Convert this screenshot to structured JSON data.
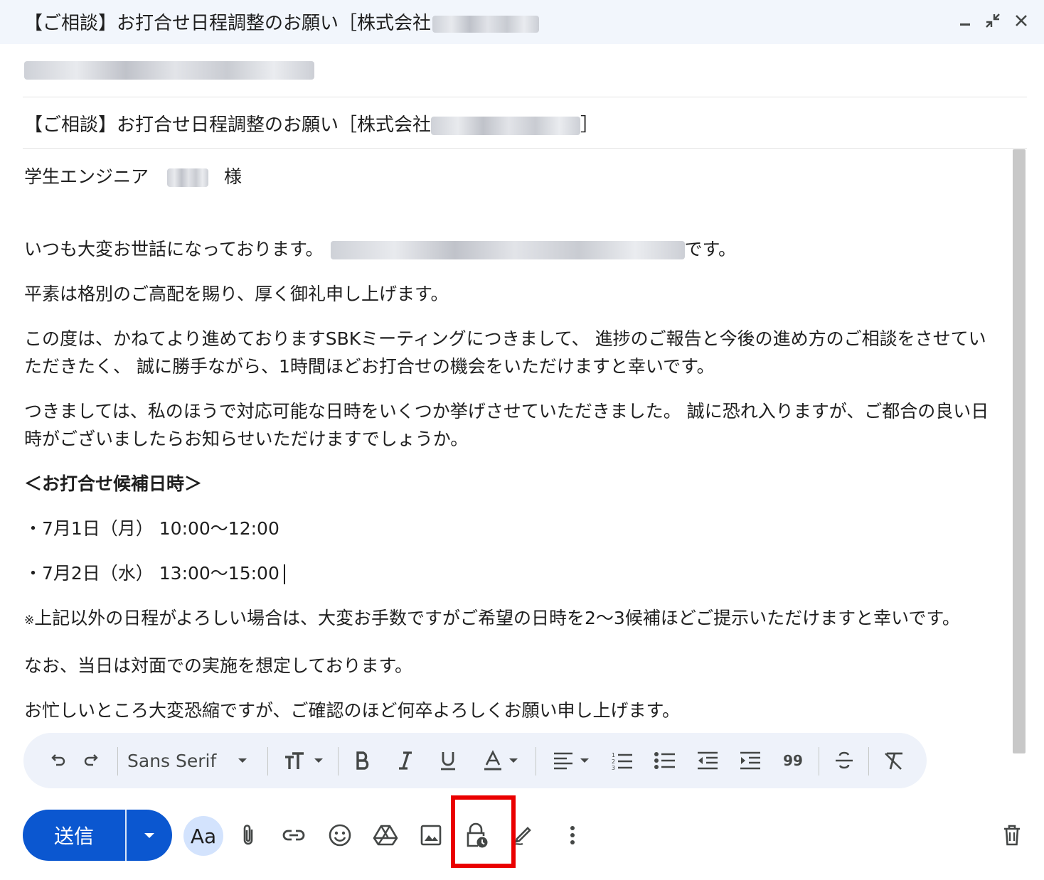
{
  "window": {
    "title": "【ご相談】お打合せ日程調整のお願い［株式会社",
    "minimize_label": "minimize-icon",
    "exit_fullscreen_label": "exit-fullscreen-icon",
    "close_label": "close-icon"
  },
  "subject": {
    "prefix": "【ご相談】お打合せ日程調整のお願い［株式会社",
    "suffix": "］"
  },
  "body": {
    "greeting_prefix": "学生エンジニア",
    "greeting_suffix": "様",
    "line1_prefix": "いつも大変お世話になっております。",
    "line1_suffix": "です。",
    "line2": "平素は格別のご高配を賜り、厚く御礼申し上げます。",
    "para3": "この度は、かねてより進めておりますSBKミーティングにつきまして、 進捗のご報告と今後の進め方のご相談をさせていただきたく、 誠に勝手ながら、1時間ほどお打合せの機会をいただけますと幸いです。",
    "para4": "つきましては、私のほうで対応可能な日時をいくつか挙げさせていただきました。 誠に恐れ入りますが、ご都合の良い日時がございましたらお知らせいただけますでしょうか。",
    "heading": "＜お打合せ候補日時＞",
    "slot1": "・7月1日（月） 10:00〜12:00",
    "slot2": "・7月2日（水） 13:00〜15:00",
    "note_mark": "※",
    "note": "上記以外の日程がよろしい場合は、大変お手数ですがご希望の日時を2〜3候補ほどご提示いただけますと幸いです。",
    "line_onsite": "なお、当日は対面での実施を想定しております。",
    "closing": "お忙しいところ大変恐縮ですが、ご確認のほど何卒よろしくお願い申し上げます。"
  },
  "format_toolbar": {
    "font_name": "Sans Serif",
    "quote_label": "99"
  },
  "actions": {
    "send_label": "送信",
    "text_format_label": "Aa"
  },
  "colors": {
    "accent": "#0b57d0",
    "highlight": "#ea0000",
    "title_bg": "#f2f6fc",
    "toolbar_bg": "#eef2fa"
  }
}
